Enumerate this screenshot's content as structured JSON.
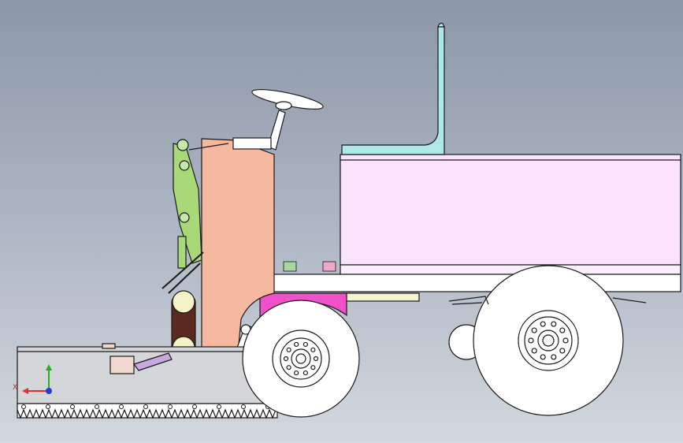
{
  "viewport": {
    "background_top": "#8c97a8",
    "background_bottom": "#d3d8df"
  },
  "triad": {
    "x_label": "X",
    "x_color": "#e03030",
    "y_color": "#20b020",
    "z_color": "#2040d0"
  },
  "model_colors": {
    "seat": "#aee8e8",
    "seat_back": "#bfeff0",
    "hood": "#f7b8a0",
    "cargo_box": "#fbe3fb",
    "fender": "#f050c8",
    "frame_arm": "#a8d878",
    "wheel": "#ffffff",
    "outline": "#1a1a1a",
    "rollers": "#5a2a20",
    "blade": "#d4d6da"
  }
}
